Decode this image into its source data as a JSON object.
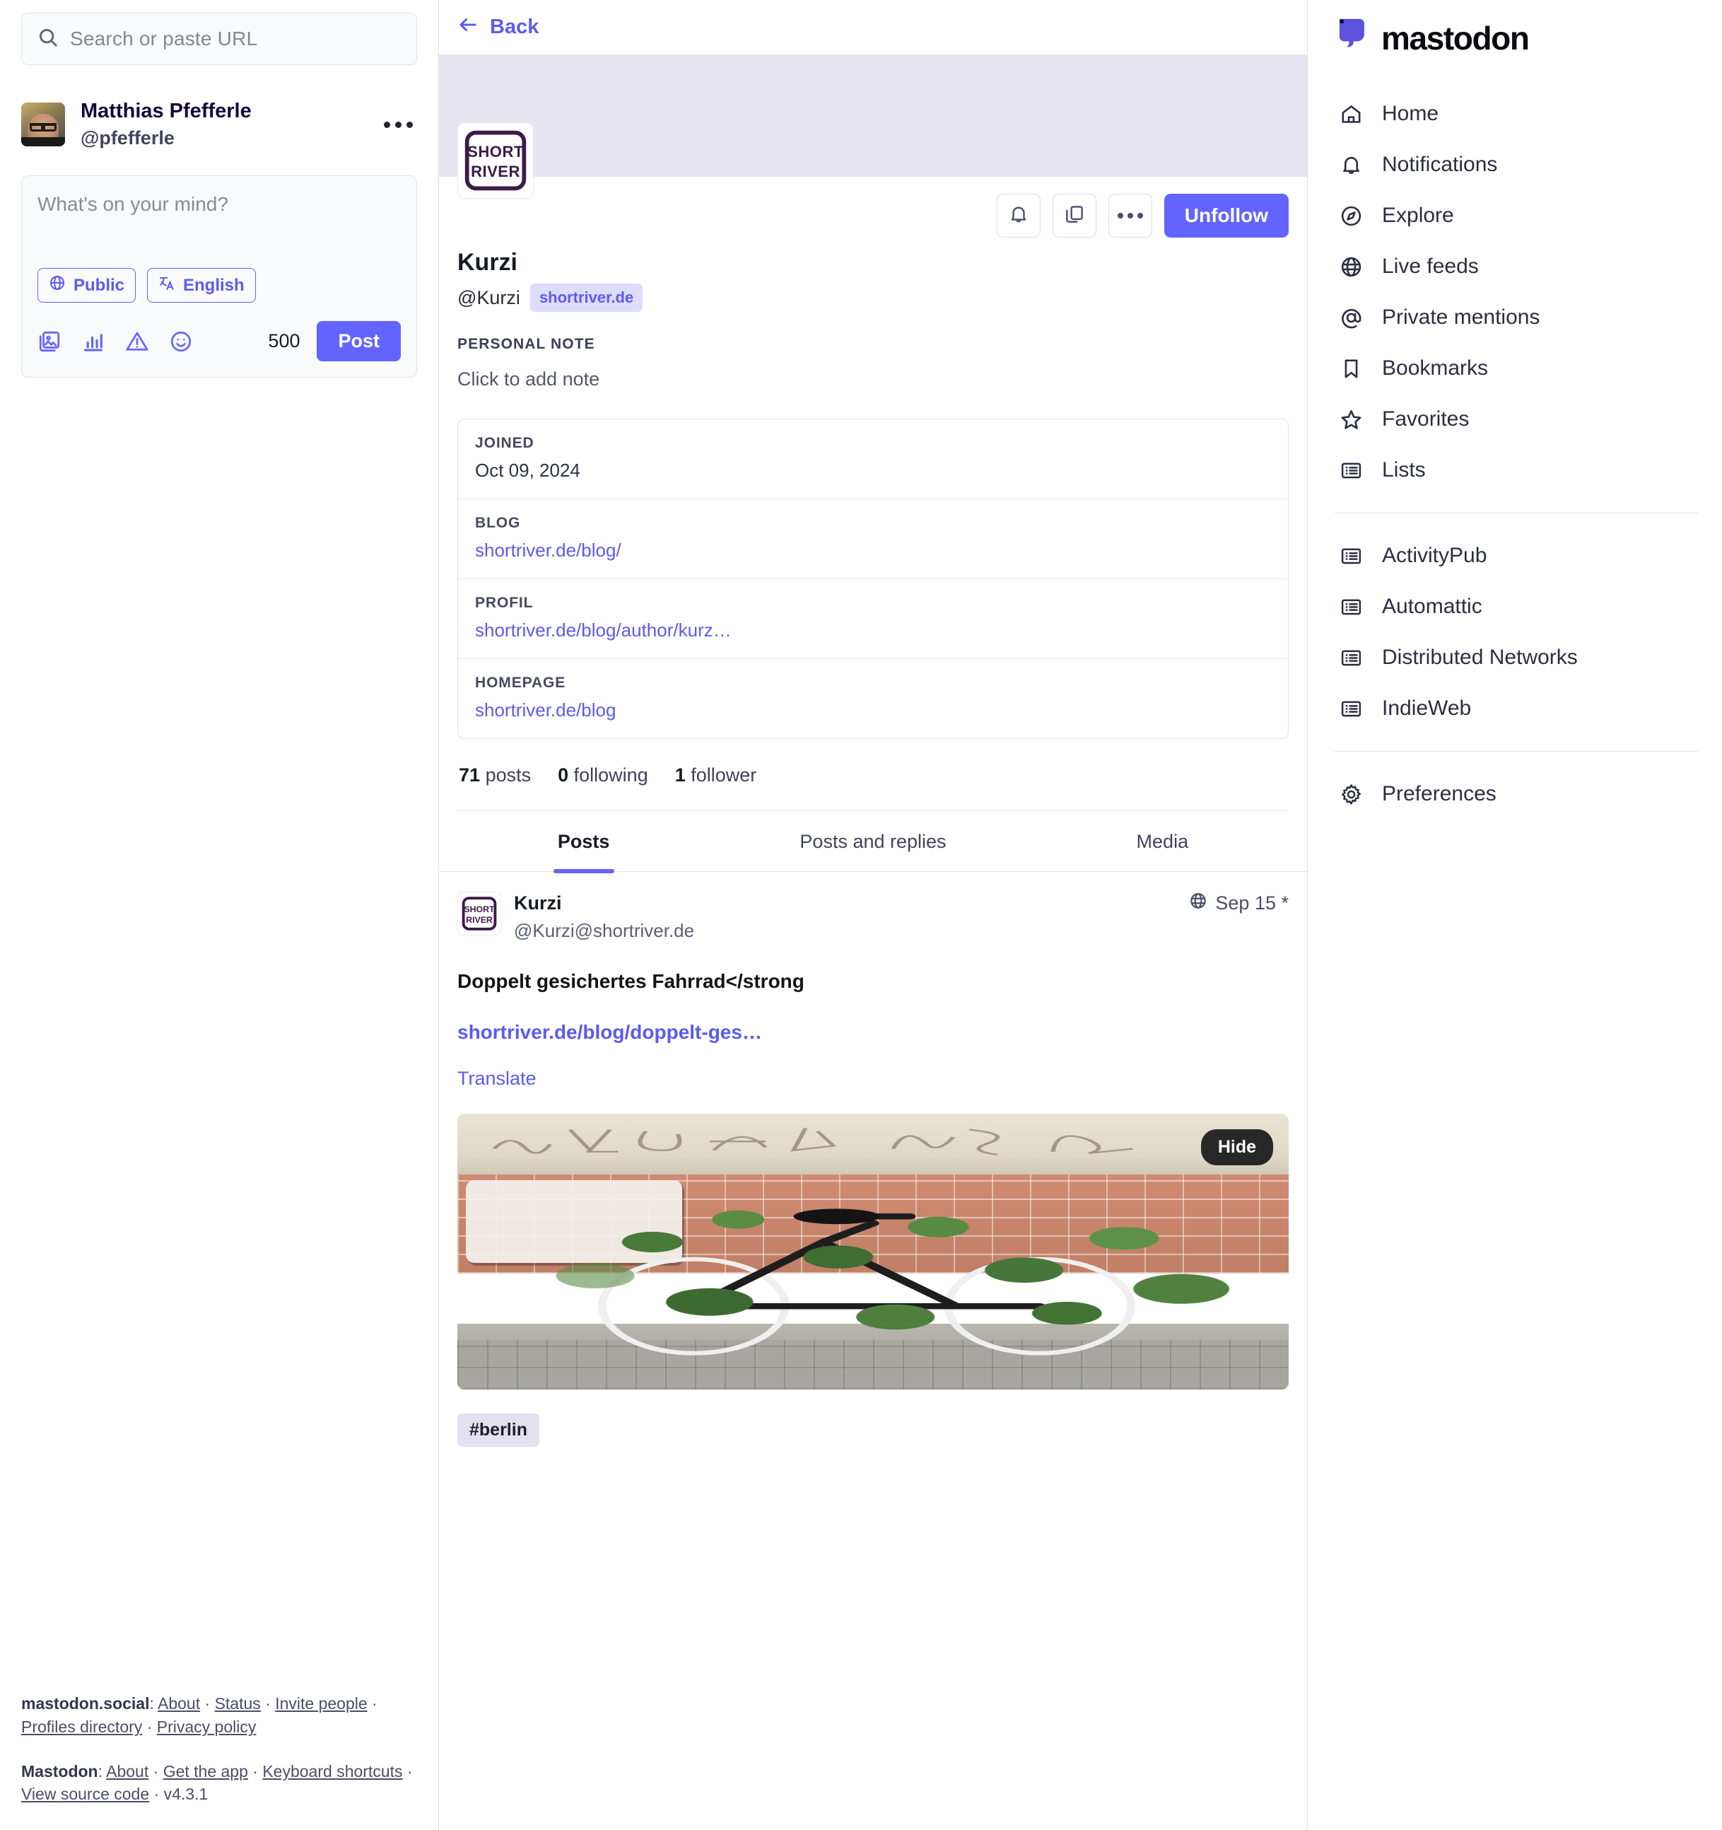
{
  "left": {
    "search": {
      "placeholder": "Search or paste URL",
      "icon": "search-icon"
    },
    "account": {
      "display_name": "Matthias Pfefferle",
      "handle": "@pfefferle",
      "menu_icon": "ellipsis-icon"
    },
    "composer": {
      "placeholder": "What's on your mind?",
      "visibility_label": "Public",
      "visibility_icon": "globe-icon",
      "language_label": "English",
      "language_icon": "translate-icon",
      "tools": [
        {
          "name": "add-media-icon",
          "label": "Add images, a video or an audio file"
        },
        {
          "name": "poll-icon",
          "label": "Add a poll"
        },
        {
          "name": "content-warning-icon",
          "label": "Add content warning"
        },
        {
          "name": "emoji-icon",
          "label": "Insert emoji"
        }
      ],
      "char_count": "500",
      "post_label": "Post"
    },
    "footer": {
      "line1_prefix": "mastodon.social",
      "line1_links": [
        "About",
        "Status",
        "Invite people",
        "Profiles directory",
        "Privacy policy"
      ],
      "line2_prefix": "Mastodon",
      "line2_links": [
        "About",
        "Get the app",
        "Keyboard shortcuts",
        "View source code"
      ],
      "version": "v4.3.1"
    }
  },
  "center": {
    "header": {
      "back_label": "Back",
      "back_icon": "arrow-left-icon"
    },
    "profile": {
      "banner_color": "#e6e4f1",
      "avatar_alt": "SHORT RIVER",
      "display_name": "Kurzi",
      "handle": "@Kurzi",
      "domain_badge": "shortriver.de",
      "actions": [
        {
          "name": "notify-bell-button",
          "icon": "bell-icon"
        },
        {
          "name": "copy-link-button",
          "icon": "copy-icon"
        },
        {
          "name": "more-options-button",
          "icon": "ellipsis-icon"
        }
      ],
      "follow_button": "Unfollow",
      "personal_note_label": "PERSONAL NOTE",
      "personal_note_value": "Click to add note",
      "metadata": [
        {
          "key": "JOINED",
          "value": "Oct 09, 2024",
          "is_link": false
        },
        {
          "key": "BLOG",
          "value": "shortriver.de/blog/",
          "is_link": true
        },
        {
          "key": "PROFIL",
          "value": "shortriver.de/blog/author/kurz…",
          "is_link": true
        },
        {
          "key": "HOMEPAGE",
          "value": "shortriver.de/blog",
          "is_link": true
        }
      ],
      "stats": [
        {
          "count": "71",
          "label": "posts"
        },
        {
          "count": "0",
          "label": "following"
        },
        {
          "count": "1",
          "label": "follower"
        }
      ]
    },
    "tabs": [
      {
        "label": "Posts",
        "active": true
      },
      {
        "label": "Posts and replies",
        "active": false
      },
      {
        "label": "Media",
        "active": false
      }
    ],
    "status": {
      "display_name": "Kurzi",
      "acct": "@Kurzi@shortriver.de",
      "visibility_icon": "globe-icon",
      "timestamp": "Sep 15 *",
      "title": "Doppelt gesichertes Fahrrad</strong",
      "link": "shortriver.de/blog/doppelt-ges…",
      "translate_label": "Translate",
      "media_hide_label": "Hide",
      "media_alt": "A bicycle overgrown by ivy in front of a graffiti-covered brick wall",
      "hashtag": "#berlin"
    }
  },
  "right": {
    "brand": {
      "text": "mastodon",
      "icon": "mastodon-logo-icon"
    },
    "nav_primary": [
      {
        "label": "Home",
        "icon": "home-icon"
      },
      {
        "label": "Notifications",
        "icon": "bell-icon"
      },
      {
        "label": "Explore",
        "icon": "compass-icon"
      },
      {
        "label": "Live feeds",
        "icon": "globe-icon"
      },
      {
        "label": "Private mentions",
        "icon": "at-icon"
      },
      {
        "label": "Bookmarks",
        "icon": "bookmark-icon"
      },
      {
        "label": "Favorites",
        "icon": "star-icon"
      },
      {
        "label": "Lists",
        "icon": "list-icon"
      }
    ],
    "nav_lists": [
      {
        "label": "ActivityPub",
        "icon": "list-icon"
      },
      {
        "label": "Automattic",
        "icon": "list-icon"
      },
      {
        "label": "Distributed Networks",
        "icon": "list-icon"
      },
      {
        "label": "IndieWeb",
        "icon": "list-icon"
      }
    ],
    "nav_settings": [
      {
        "label": "Preferences",
        "icon": "gear-icon"
      }
    ]
  },
  "colors": {
    "accent": "#6364ff",
    "link": "#5b5bf0",
    "banner": "#e6e4f1",
    "badge_bg": "#dedcfb"
  }
}
